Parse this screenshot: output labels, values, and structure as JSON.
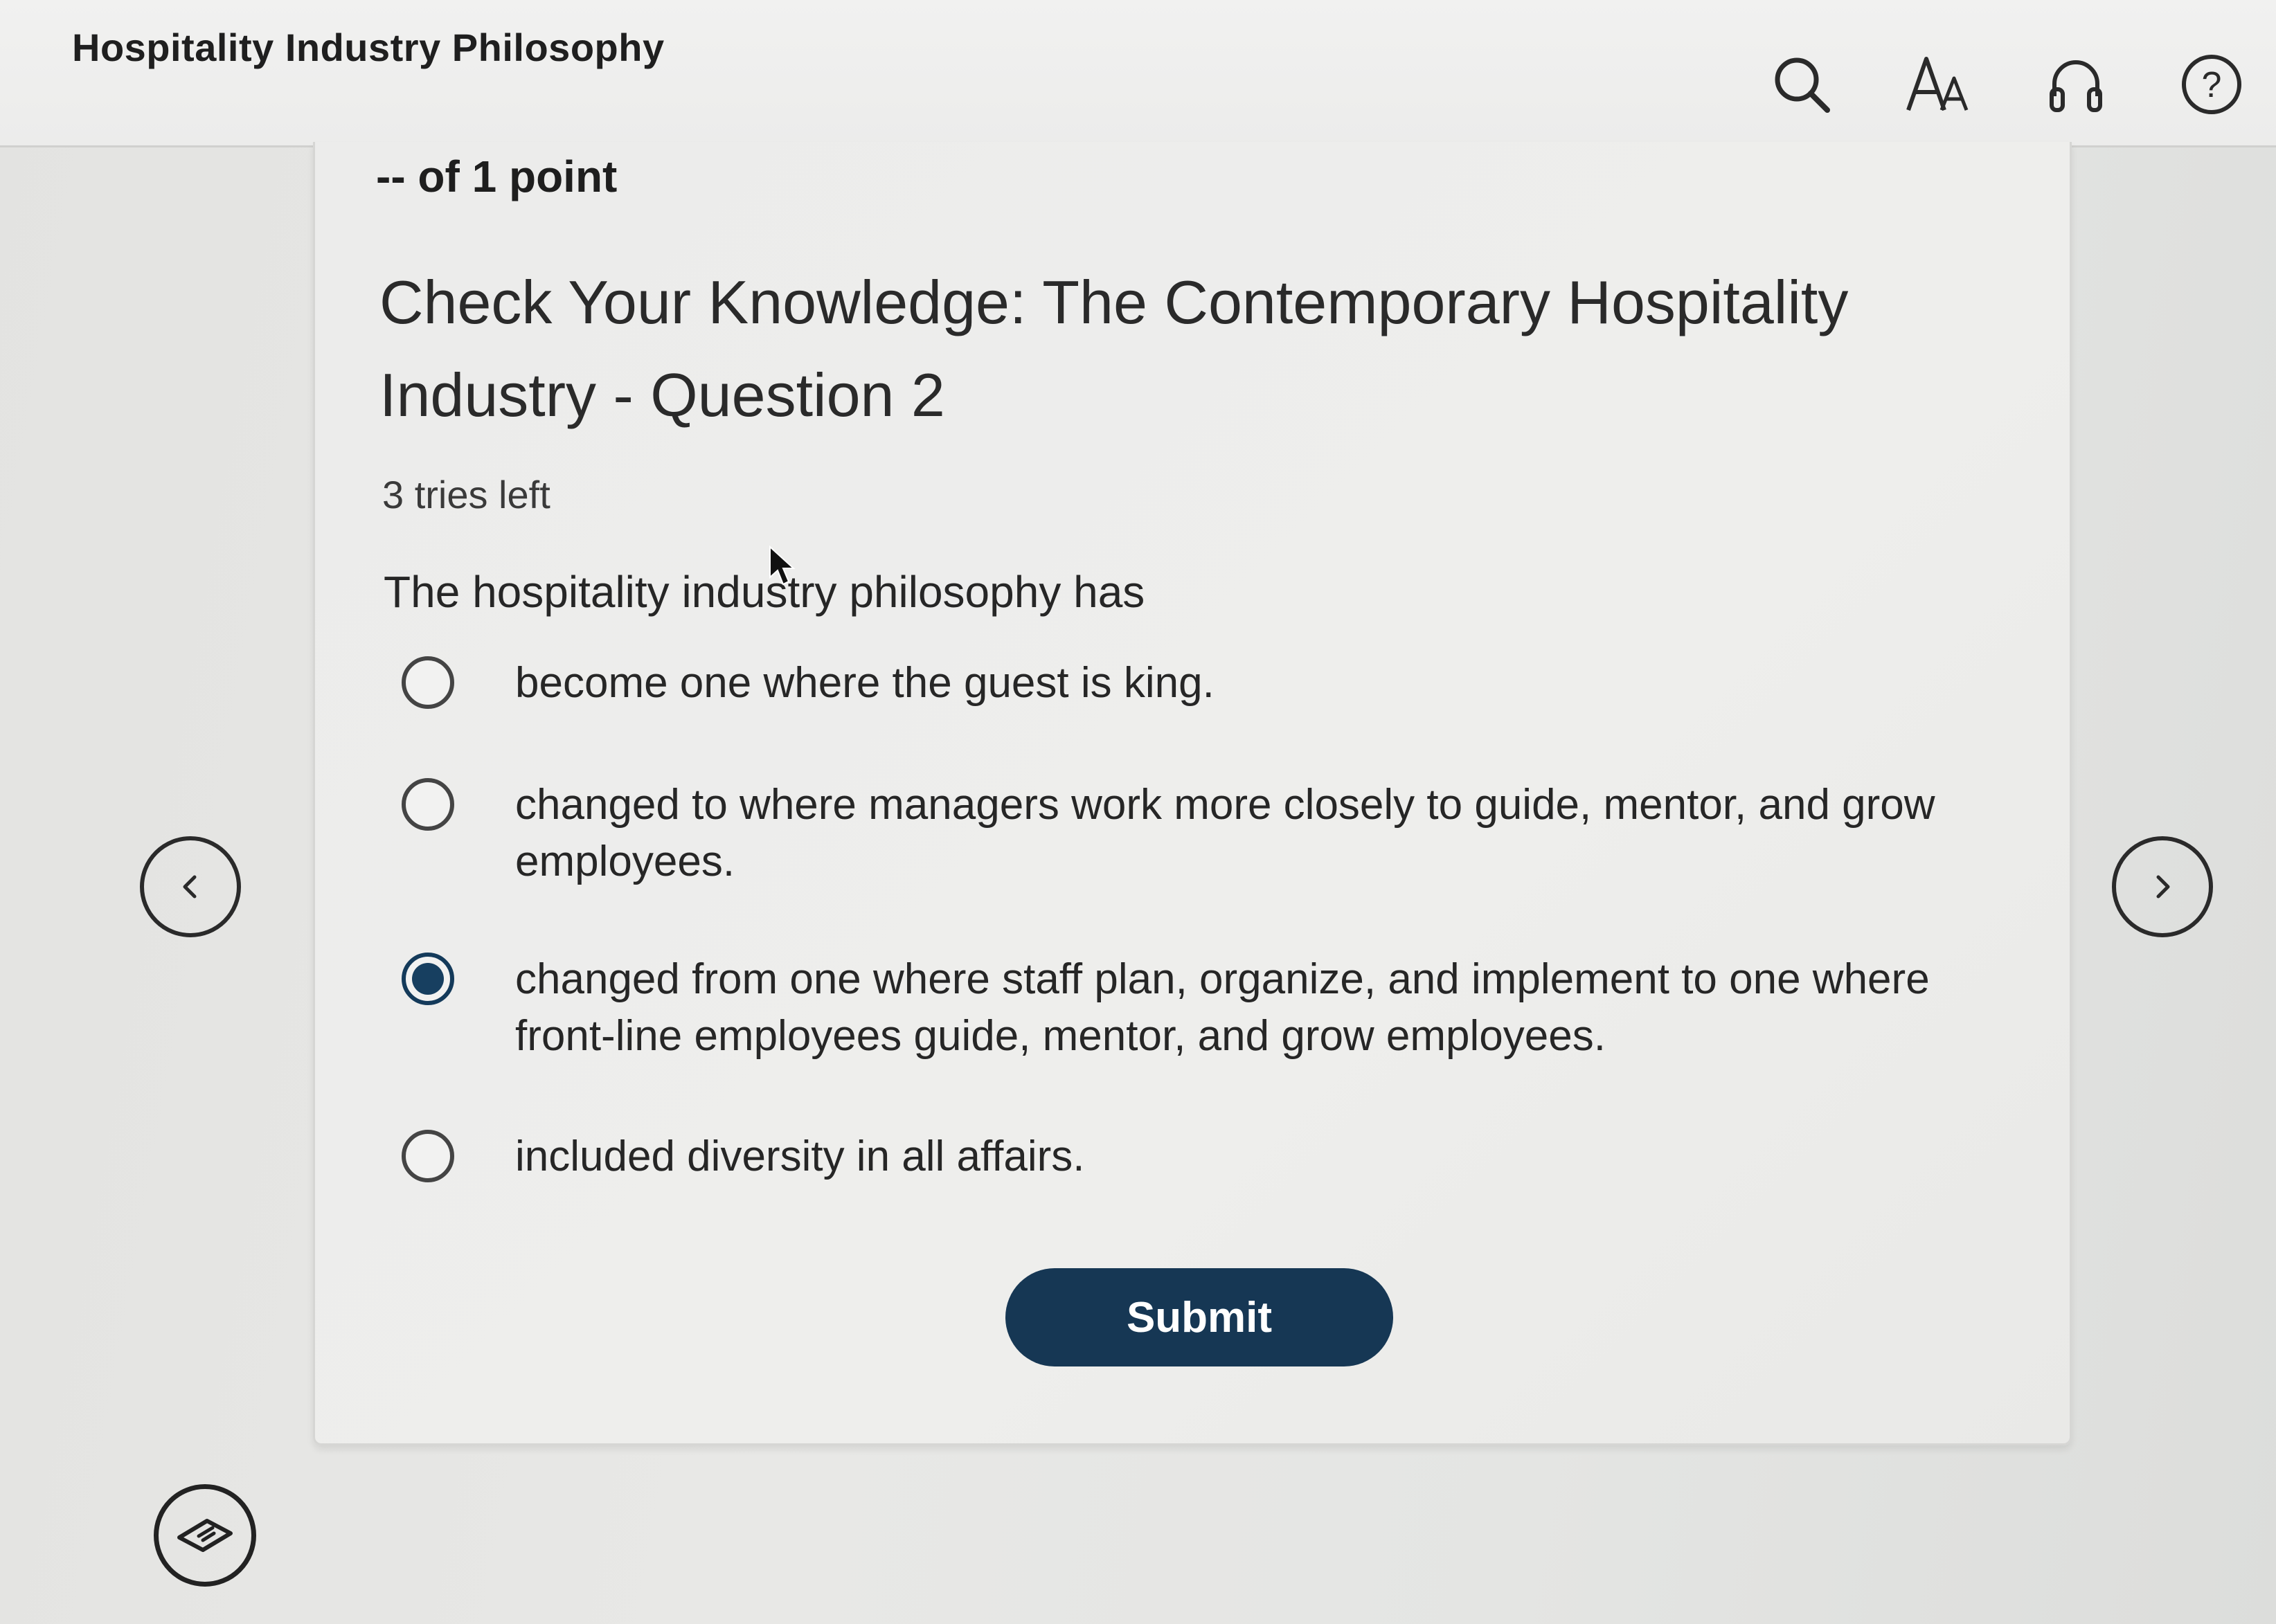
{
  "header": {
    "title": "Hospitality Industry Philosophy",
    "icons": [
      "search-icon",
      "text-size-icon",
      "headphones-icon",
      "help-icon"
    ]
  },
  "question": {
    "points": "-- of 1 point",
    "title": "Check Your Knowledge: The Contemporary Hospitality Industry - Question 2",
    "tries": "3 tries left",
    "prompt": "The hospitality industry philosophy has",
    "options": [
      {
        "label": "become one where the guest is king.",
        "selected": false
      },
      {
        "label": "changed to where managers work more closely to guide, mentor, and grow employees.",
        "selected": false
      },
      {
        "label": "changed from one where staff plan, organize, and implement to one where front-line employees guide, mentor, and grow employees.",
        "selected": true
      },
      {
        "label": "included diversity in all affairs.",
        "selected": false
      }
    ],
    "submit_label": "Submit"
  },
  "navigation": {
    "prev_icon": "chevron-left-icon",
    "next_icon": "chevron-right-icon",
    "bottom_icon": "book-icon"
  },
  "colors": {
    "accent": "#163754",
    "radio_selected": "#173f60"
  }
}
